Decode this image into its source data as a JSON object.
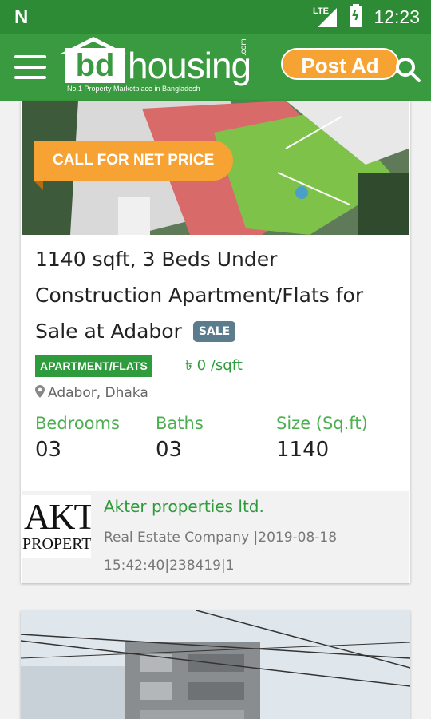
{
  "status_bar": {
    "network": "LTE",
    "time": "12:23"
  },
  "app_bar": {
    "logo_bd": "bd",
    "logo_housing": "housing",
    "logo_com": ".com",
    "logo_tagline": "No.1 Property Marketplace in Bangladesh",
    "post_ad_label": "Post Ad"
  },
  "listing": {
    "ribbon": "CALL FOR NET PRICE",
    "title": "1140 sqft, 3 Beds Under Construction Apartment/Flats for Sale at Adabor",
    "sale_badge": "SALE",
    "type_badge": "APARTMENT/FLATS",
    "price": "৳ 0 /sqft",
    "location": "Adabor, Dhaka",
    "specs": [
      {
        "label": "Bedrooms",
        "value": "03"
      },
      {
        "label": "Baths",
        "value": "03"
      },
      {
        "label": "Size (Sq.ft)",
        "value": "1140"
      }
    ],
    "agency": {
      "logo_line1": "AKT",
      "logo_line2": "PROPERTY",
      "name": "Akter properties ltd.",
      "meta": "Real Estate Company |2019-08-18 15:42:40|238419|1"
    }
  },
  "colors": {
    "brand_green": "#3a9a3f",
    "status_green": "#2e8b35",
    "accent_orange": "#f7a334",
    "badge_slate": "#5b7c8d"
  }
}
